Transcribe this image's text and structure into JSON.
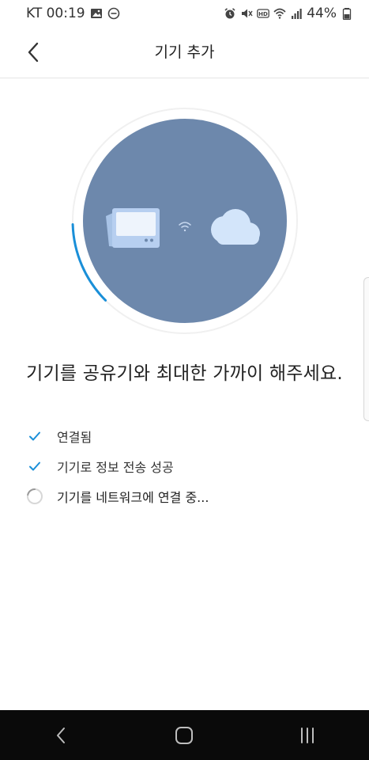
{
  "status_bar": {
    "carrier_time": "KT 00:19",
    "battery_percent": "44%",
    "icons": [
      "image-icon",
      "do-not-disturb-icon",
      "alarm-icon",
      "mute-icon",
      "hd-icon",
      "wifi-icon",
      "signal-icon",
      "battery-icon"
    ]
  },
  "header": {
    "title": "기기 추가",
    "back_icon": "chevron-left-icon"
  },
  "illustration": {
    "device_icon": "device-card-icon",
    "wifi_icon": "wifi-icon",
    "cloud_icon": "cloud-icon",
    "progress": 0.12,
    "circle_color": "#6d88ac",
    "progress_color": "#1a8fd8"
  },
  "main": {
    "message": "기기를 공유기와 최대한 가까이 해주세요."
  },
  "steps": [
    {
      "label": "연결됨",
      "status": "done"
    },
    {
      "label": "기기로 정보 전송 성공",
      "status": "done"
    },
    {
      "label": "기기를 네트워크에 연결 중...",
      "status": "in-progress"
    }
  ],
  "nav_bar": {
    "back_icon": "nav-back-icon",
    "home_icon": "nav-home-icon",
    "recents_icon": "nav-recents-icon"
  },
  "colors": {
    "accent": "#1a8fd8",
    "nav_background": "#0a0a0a"
  }
}
